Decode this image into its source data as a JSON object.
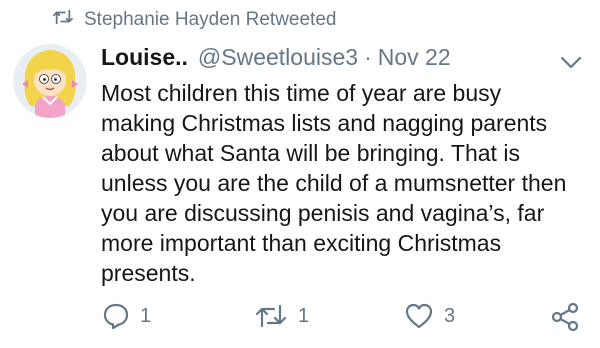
{
  "retweet_banner": {
    "icon": "retweet-icon",
    "text": "Stephanie Hayden Retweeted"
  },
  "tweet": {
    "avatar_icon": "cartoon-avatar",
    "display_name": "Louise..",
    "handle": "@Sweetlouise3",
    "separator": "·",
    "date": "Nov 22",
    "menu_icon": "chevron-down-icon",
    "text": "Most children this time of year are busy\nmaking Christmas lists and nagging parents\nabout what Santa will be bringing. That is\nunless you are the child of a mumsnetter then\nyou are discussing penisis and vagina’s, far\nmore important than exciting Christmas\npresents."
  },
  "actions": {
    "reply": {
      "icon": "reply-icon",
      "count": "1"
    },
    "retweet": {
      "icon": "retweet-icon",
      "count": "1"
    },
    "like": {
      "icon": "heart-icon",
      "count": "3"
    },
    "share": {
      "icon": "share-icon"
    }
  },
  "colors": {
    "text": "#14171a",
    "muted": "#657786",
    "background": "#ffffff"
  }
}
